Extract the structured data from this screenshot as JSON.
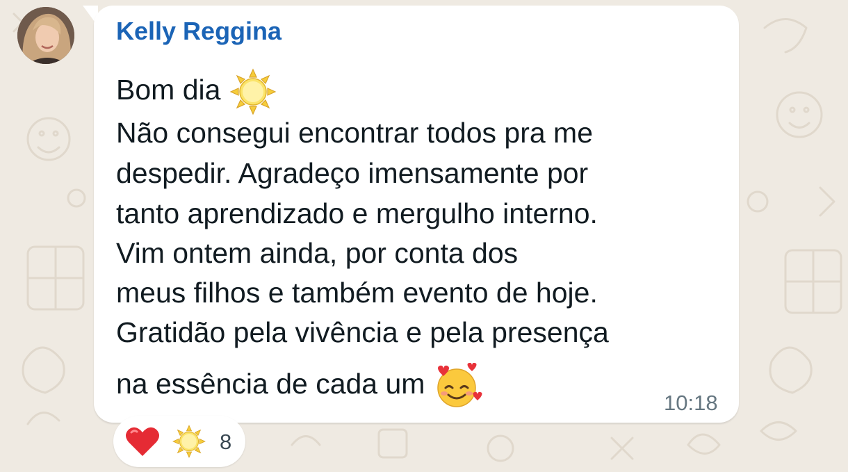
{
  "message": {
    "sender_name": "Kelly Reggina",
    "lines": [
      "Bom dia",
      "Não consegui encontrar todos pra me",
      "despedir. Agradeço imensamente por",
      "tanto aprendizado e mergulho interno.",
      "Vim ontem ainda, por conta dos",
      "meus filhos e também evento de hoje.",
      "Gratidão pela vivência e pela presença",
      "na essência de cada um"
    ],
    "emojis": {
      "greeting": "sun-emoji",
      "closing": "smiling-face-with-hearts-emoji"
    },
    "timestamp": "10:18"
  },
  "reactions": {
    "emojis": [
      "red-heart-emoji",
      "sun-emoji"
    ],
    "count": "8"
  },
  "colors": {
    "background": "#efeae2",
    "bubble": "#ffffff",
    "sender_name": "#1b64b6",
    "message_text": "#111b21",
    "timestamp": "#667781"
  }
}
